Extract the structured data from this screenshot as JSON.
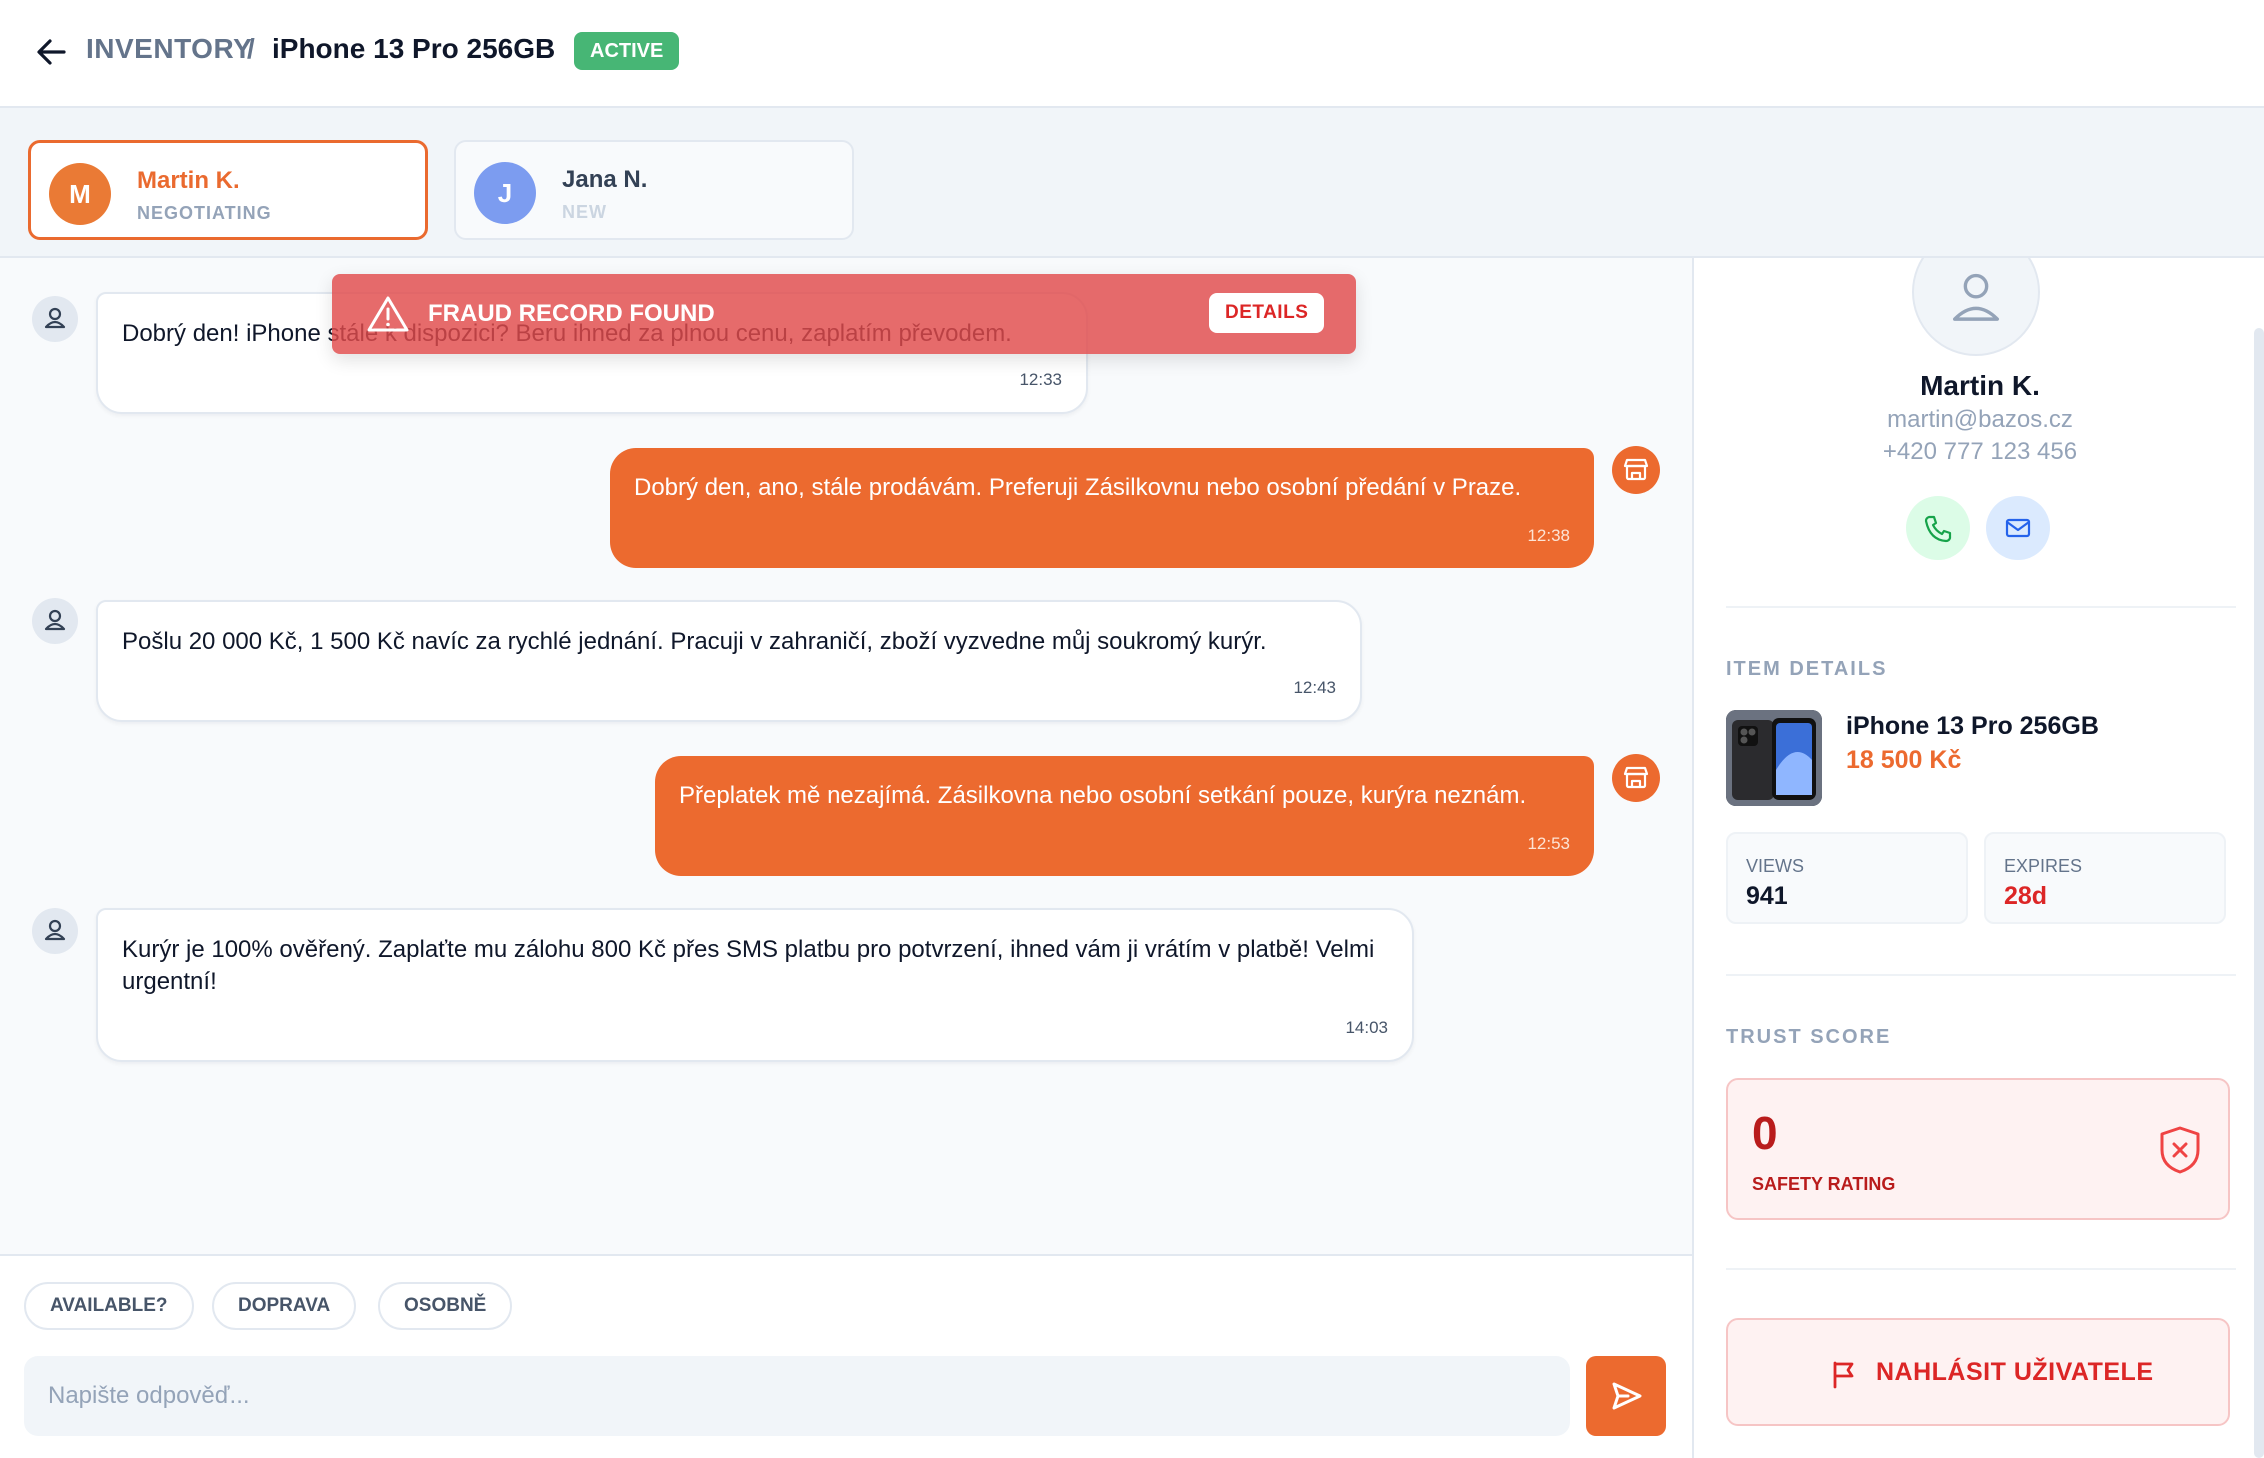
{
  "header": {
    "breadcrumb_root": "INVENTORY",
    "breadcrumb_separator": "/",
    "title": "iPhone 13 Pro 256GB",
    "status": "ACTIVE"
  },
  "conversations": [
    {
      "initial": "M",
      "name": "Martin K.",
      "status": "NEGOTIATING",
      "active": true
    },
    {
      "initial": "J",
      "name": "Jana N.",
      "status": "NEW",
      "active": false
    }
  ],
  "alert": {
    "title": "FRAUD RECORD FOUND",
    "action": "DETAILS"
  },
  "messages": [
    {
      "from": "buyer",
      "text": "Dobrý den! iPhone stále k dispozici? Beru ihned za plnou cenu, zaplatím převodem.",
      "time": "12:33"
    },
    {
      "from": "seller",
      "text": "Dobrý den, ano, stále prodávám. Preferuji Zásilkovnu nebo osobní předání v Praze.",
      "time": "12:38"
    },
    {
      "from": "buyer",
      "text": "Pošlu 20 000 Kč, 1 500 Kč navíc za rychlé jednání. Pracuji v zahraničí, zboží vyzvedne můj soukromý kurýr.",
      "time": "12:43"
    },
    {
      "from": "seller",
      "text": "Přeplatek mě nezajímá. Zásilkovna nebo osobní setkání pouze, kurýra neznám.",
      "time": "12:53"
    },
    {
      "from": "buyer",
      "text": "Kurýr je 100% ověřený. Zaplaťte mu zálohu 800 Kč přes SMS platbu pro potvrzení, ihned vám ji vrátím v platbě! Velmi urgentní!",
      "time": "14:03"
    }
  ],
  "quick_replies": [
    "AVAILABLE?",
    "DOPRAVA",
    "OSOBNĚ"
  ],
  "composer": {
    "placeholder": "Napište odpověď..."
  },
  "contact": {
    "name": "Martin K.",
    "email": "martin@bazos.cz",
    "phone": "+420 777 123 456"
  },
  "item_details": {
    "section_title": "ITEM DETAILS",
    "name": "iPhone 13 Pro 256GB",
    "price": "18 500 Kč",
    "views_label": "VIEWS",
    "views": "941",
    "expires_label": "EXPIRES",
    "expires": "28d"
  },
  "trust": {
    "section_title": "TRUST SCORE",
    "score": "0",
    "label": "SAFETY RATING"
  },
  "report": {
    "label": "NAHLÁSIT UŽIVATELE"
  },
  "colors": {
    "accent": "#ec6a2f",
    "success": "#47b675",
    "danger": "#dc2626",
    "jana_avatar": "#7c9cf0"
  }
}
